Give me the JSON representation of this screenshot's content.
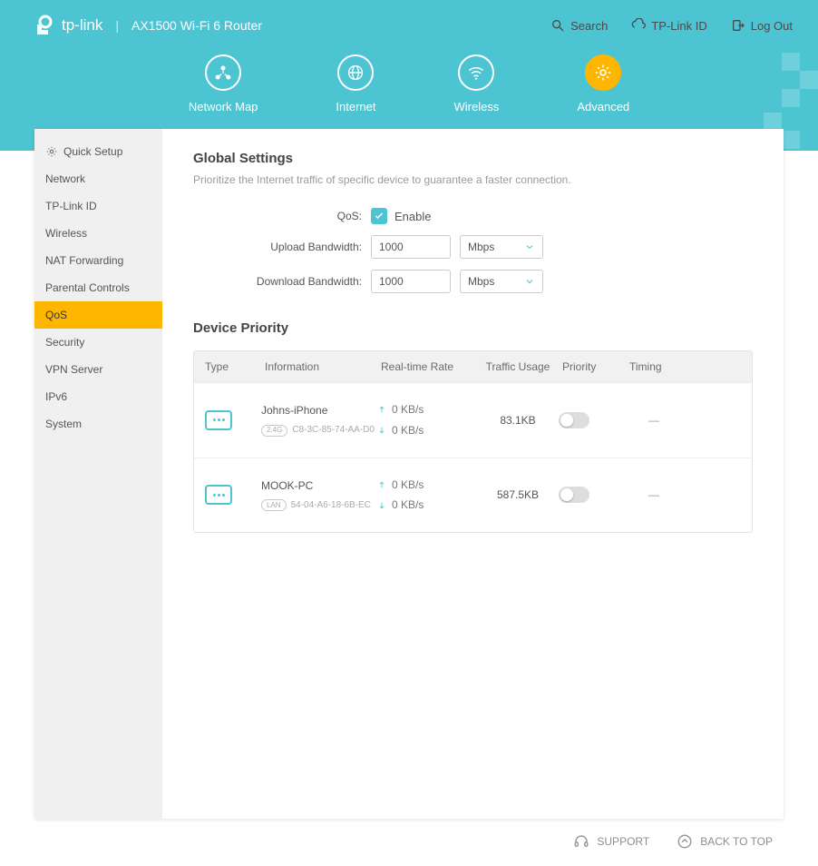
{
  "brand": "tp-link",
  "product": "AX1500 Wi-Fi 6 Router",
  "topLinks": {
    "search": "Search",
    "tplinkId": "TP-Link ID",
    "logout": "Log Out"
  },
  "tabs": {
    "networkMap": "Network Map",
    "internet": "Internet",
    "wireless": "Wireless",
    "advanced": "Advanced"
  },
  "sidebar": {
    "items": [
      "Quick Setup",
      "Network",
      "TP-Link ID",
      "Wireless",
      "NAT Forwarding",
      "Parental Controls",
      "QoS",
      "Security",
      "VPN Server",
      "IPv6",
      "System"
    ],
    "activeIndex": 6
  },
  "global": {
    "title": "Global Settings",
    "desc": "Prioritize the Internet traffic of specific device to guarantee a faster connection.",
    "qosLabel": "QoS:",
    "enable": "Enable",
    "uploadLabel": "Upload Bandwidth:",
    "uploadValue": "1000",
    "uploadUnit": "Mbps",
    "downloadLabel": "Download Bandwidth:",
    "downloadValue": "1000",
    "downloadUnit": "Mbps"
  },
  "devicePriority": {
    "title": "Device Priority",
    "columns": {
      "type": "Type",
      "info": "Information",
      "rate": "Real-time Rate",
      "usage": "Traffic Usage",
      "priority": "Priority",
      "timing": "Timing"
    },
    "rows": [
      {
        "name": "Johns-iPhone",
        "conn": "2.4G",
        "mac": "C8-3C-85-74-AA-D0",
        "up": "0 KB/s",
        "down": "0 KB/s",
        "usage": "83.1KB",
        "timing": "—"
      },
      {
        "name": "MOOK-PC",
        "conn": "LAN",
        "mac": "54-04-A6-18-6B-EC",
        "up": "0 KB/s",
        "down": "0 KB/s",
        "usage": "587.5KB",
        "timing": "—"
      }
    ]
  },
  "footer": {
    "support": "SUPPORT",
    "backToTop": "BACK TO TOP"
  }
}
